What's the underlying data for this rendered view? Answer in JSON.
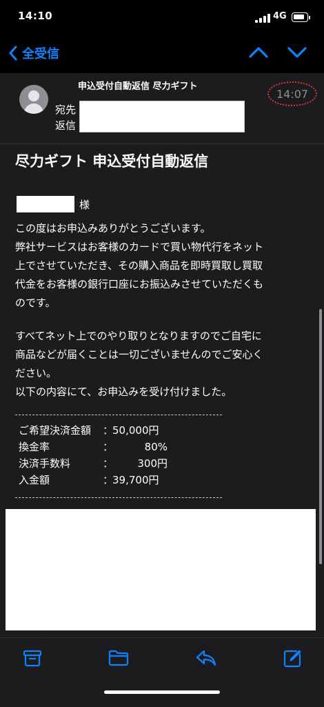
{
  "status": {
    "time": "14:10",
    "network": "4G"
  },
  "nav": {
    "back_label": "全受信"
  },
  "header": {
    "subject": "申込受付自動返信 尽力ギフト",
    "to_label": "宛先",
    "reply_label": "返信",
    "time": "14:07"
  },
  "email": {
    "title": "尽力ギフト 申込受付自動返信",
    "salutation": "様",
    "paragraph1_line1": "この度はお申込みありがとうございます。",
    "paragraph1_line2": "弊社サービスはお客様のカードで買い物代行をネット",
    "paragraph1_line3": "上でさせていただき、その購入商品を即時買取し買取",
    "paragraph1_line4": "代金をお客様の銀行口座にお振込みさせていただくも",
    "paragraph1_line5": "のです。",
    "paragraph2_line1": "すべてネット上でのやり取りとなりますのでご自宅に",
    "paragraph2_line2": "商品などが届くことは一切ございませんのでご安心く",
    "paragraph2_line3": "ださい。",
    "paragraph2_line4": "以下の内容にて、お申込みを受け付けました。",
    "rows": [
      {
        "label": "ご希望決済金額",
        "colon": "：",
        "value": "50,000円"
      },
      {
        "label": "換金率",
        "colon": "：",
        "value": "80%"
      },
      {
        "label": "決済手数料",
        "colon": "：",
        "value": "300円"
      },
      {
        "label": "入金額",
        "colon": "：",
        "value": "39,700円"
      }
    ]
  },
  "toolbar": {
    "icons": [
      "archive-icon",
      "folder-icon",
      "reply-icon",
      "compose-icon"
    ]
  },
  "colors": {
    "accent": "#0a84ff",
    "background": "#1c1c1e",
    "highlight": "#e0393e"
  }
}
